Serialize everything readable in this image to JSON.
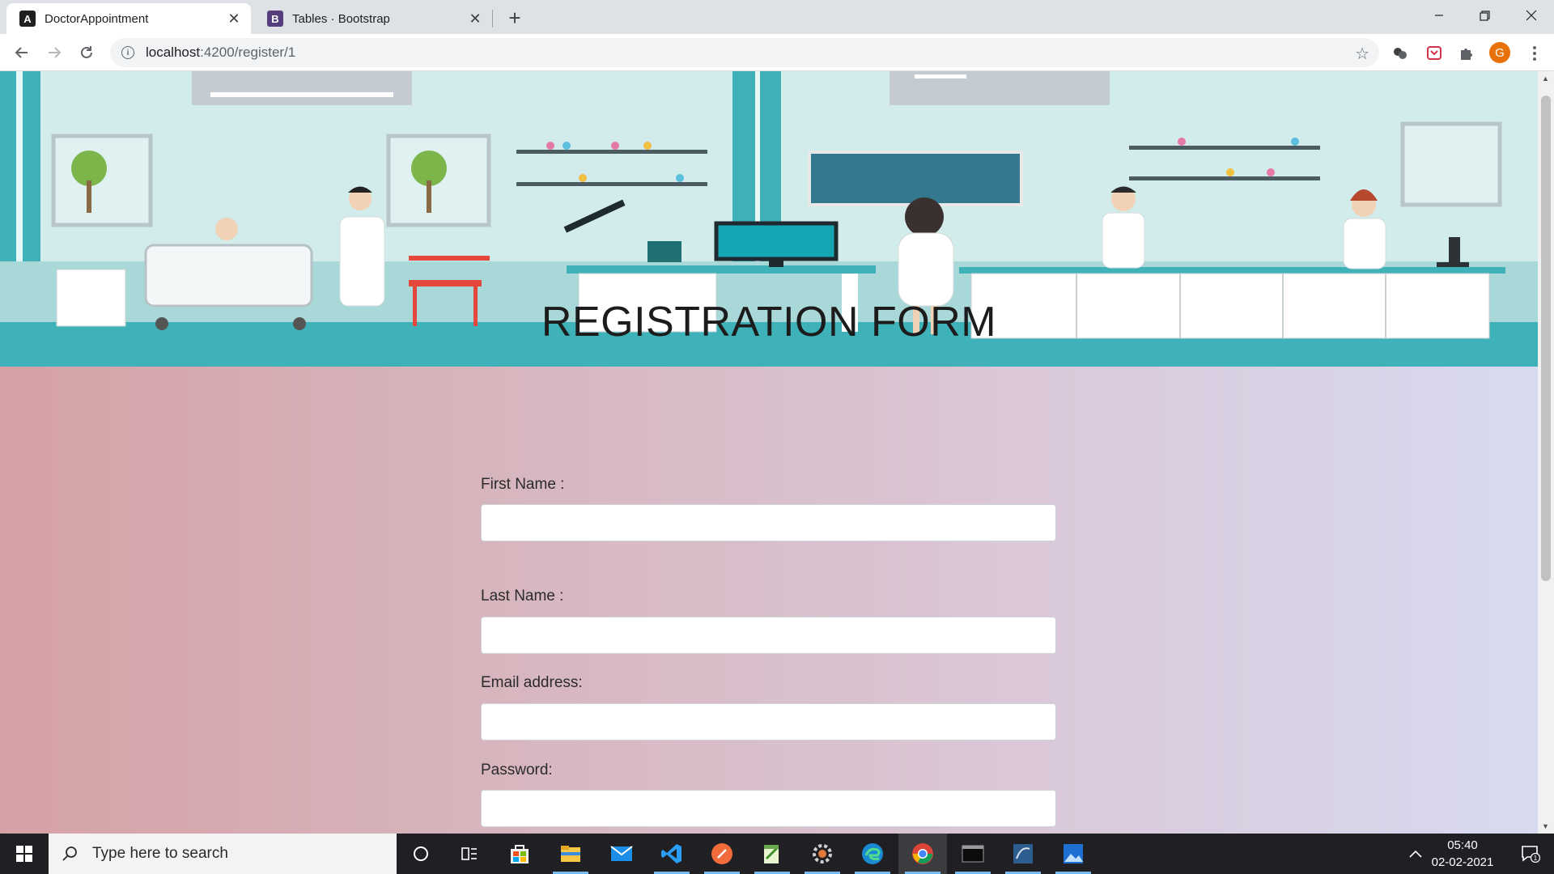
{
  "browser": {
    "tabs": [
      {
        "title": "DoctorAppointment",
        "favicon": "angular-icon",
        "active": true
      },
      {
        "title": "Tables · Bootstrap",
        "favicon": "bootstrap-icon",
        "active": false
      }
    ],
    "url_host": "localhost",
    "url_rest": ":4200/register/1",
    "profile_initial": "G"
  },
  "page": {
    "banner_alt": "hospital-laboratory-illustration",
    "form_title": "REGISTRATION FORM",
    "fields": [
      {
        "label": "First Name :",
        "value": "",
        "type": "text"
      },
      {
        "label": "Last Name :",
        "value": "",
        "type": "text"
      },
      {
        "label": "Email address:",
        "value": "",
        "type": "email"
      },
      {
        "label": "Password:",
        "value": "",
        "type": "password"
      }
    ]
  },
  "taskbar": {
    "search_placeholder": "Type here to search",
    "apps": [
      "cortana-icon",
      "task-view-icon",
      "store-icon",
      "file-explorer-icon",
      "mail-icon",
      "vscode-icon",
      "postman-icon",
      "notepad-icon",
      "settings-icon",
      "edge-icon",
      "chrome-icon",
      "terminal-icon",
      "sql-icon",
      "photos-icon"
    ],
    "time": "05:40",
    "date": "02-02-2021",
    "notification_count": "1"
  },
  "colors": {
    "accent_teal": "#3bb0b8",
    "tab_bar": "#dee1e6",
    "taskbar": "#202024"
  }
}
